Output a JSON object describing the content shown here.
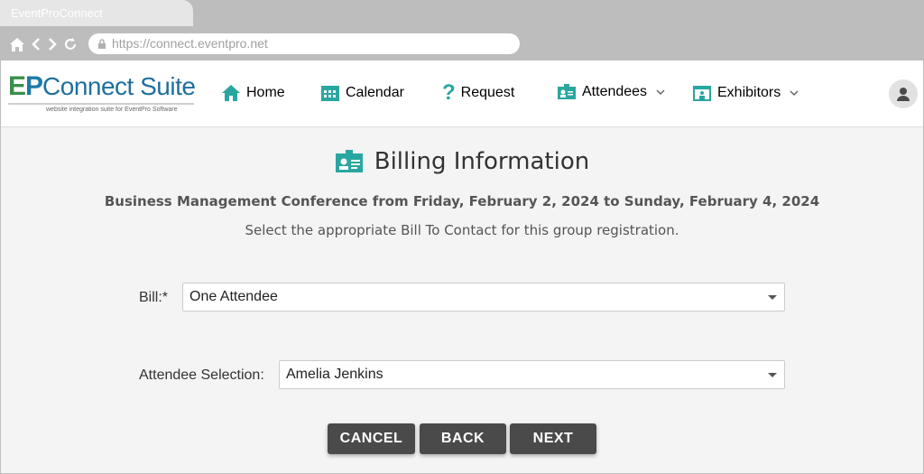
{
  "browser": {
    "tab_title": "EventProConnect",
    "url": "https://connect.eventpro.net"
  },
  "logo": {
    "ep": "EP",
    "connect_suite": "Connect Suite",
    "tagline": "website integration suite for EventPro Software"
  },
  "nav": {
    "home": "Home",
    "calendar": "Calendar",
    "request": "Request",
    "attendees": "Attendees",
    "exhibitors": "Exhibitors"
  },
  "page": {
    "title": "Billing Information",
    "subtitle": "Business Management Conference from Friday, February 2, 2024 to Sunday, February 4, 2024",
    "instructions": "Select the appropriate Bill To Contact for this group registration."
  },
  "form": {
    "bill_label": "Bill:",
    "required_marker": "*",
    "bill_value": "One Attendee",
    "attendee_label": "Attendee Selection:",
    "attendee_value": "Amelia Jenkins"
  },
  "buttons": {
    "cancel": "CANCEL",
    "back": "BACK",
    "next": "NEXT"
  },
  "colors": {
    "accent_teal": "#2aa6a0",
    "button_dark": "#4a4a4a"
  }
}
